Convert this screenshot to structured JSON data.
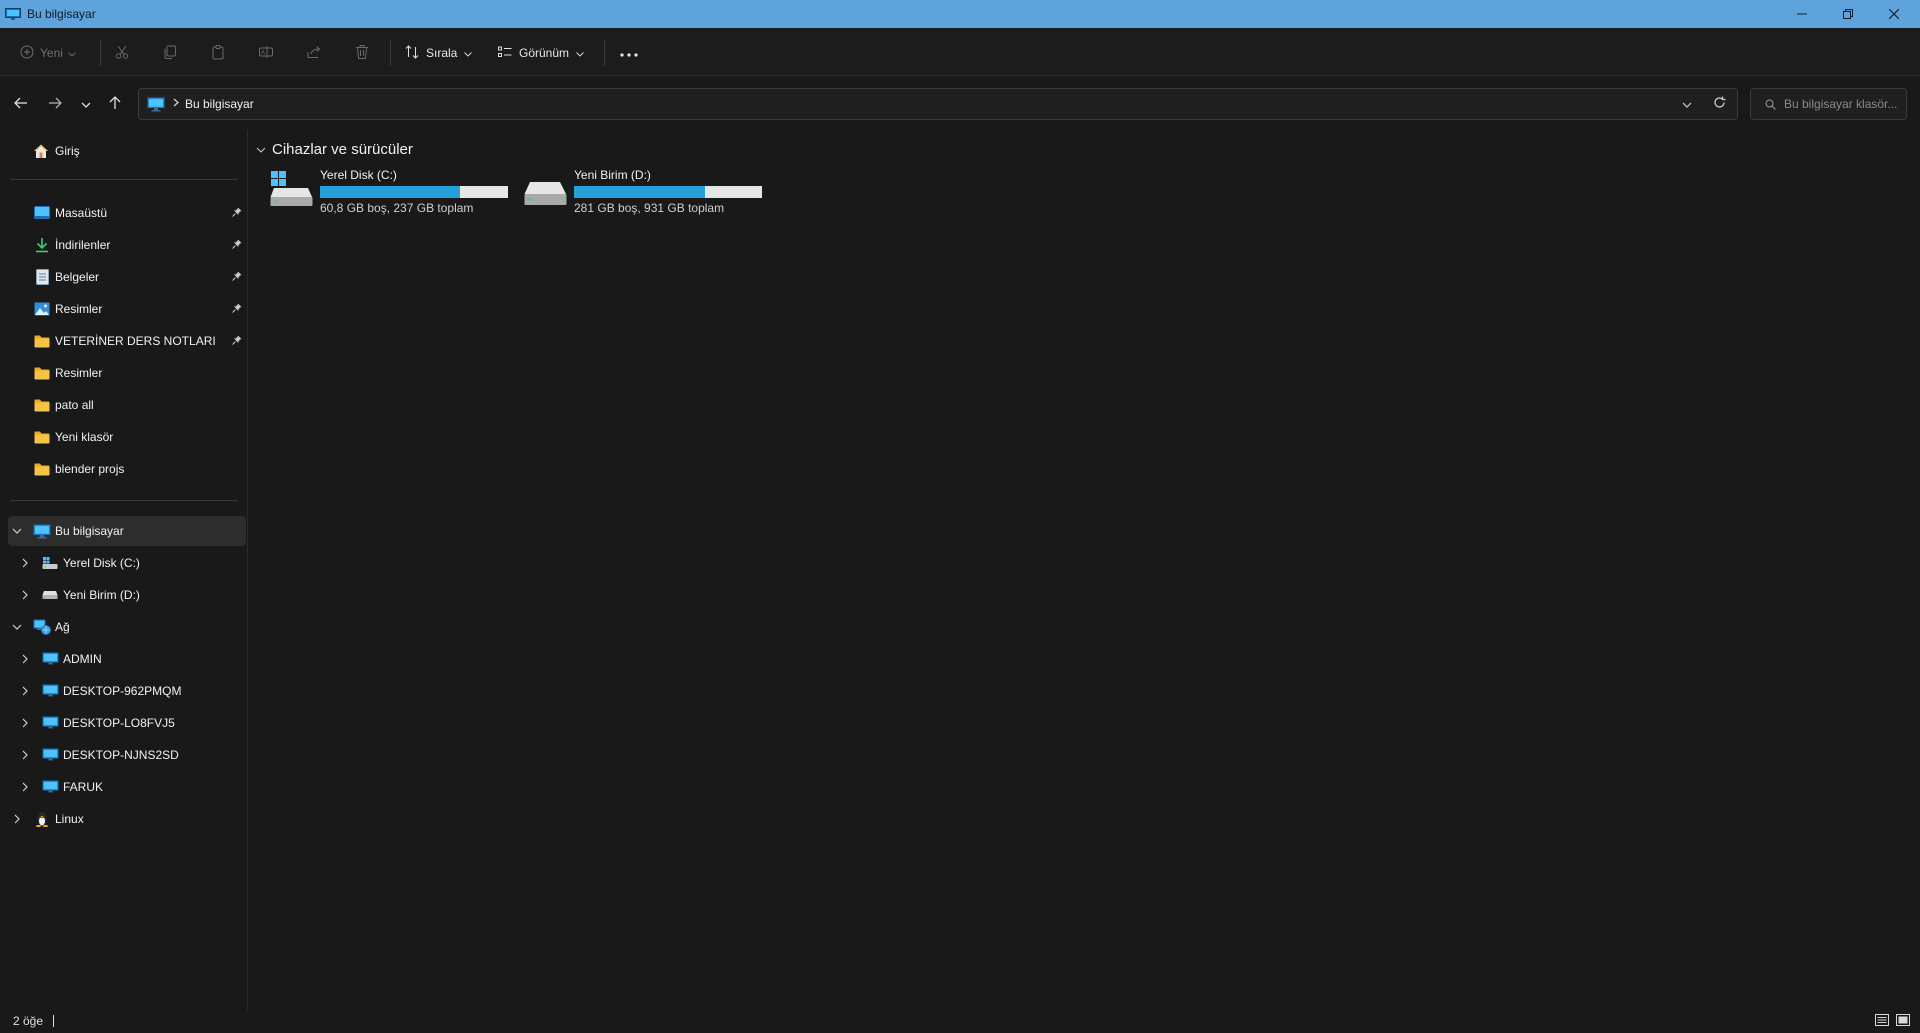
{
  "window": {
    "title": "Bu bilgisayar"
  },
  "toolbar": {
    "new_label": "Yeni",
    "sort_label": "Sırala",
    "view_label": "Görünüm",
    "more_label": "..."
  },
  "address": {
    "crumb": "Bu bilgisayar",
    "search_placeholder": "Bu bilgisayar klasör..."
  },
  "sidebar": {
    "home": "Giriş",
    "quick_access": [
      {
        "label": "Masaüstü",
        "icon": "desktop-icon",
        "pinned": true
      },
      {
        "label": "İndirilenler",
        "icon": "download-icon",
        "pinned": true
      },
      {
        "label": "Belgeler",
        "icon": "documents-icon",
        "pinned": true
      },
      {
        "label": "Resimler",
        "icon": "pictures-icon",
        "pinned": true
      },
      {
        "label": "VETERİNER DERS NOTLARI",
        "icon": "folder-icon",
        "pinned": true
      },
      {
        "label": "Resimler",
        "icon": "folder-icon",
        "pinned": false
      },
      {
        "label": "pato all",
        "icon": "folder-icon",
        "pinned": false
      },
      {
        "label": "Yeni klasör",
        "icon": "folder-icon",
        "pinned": false
      },
      {
        "label": "blender projs",
        "icon": "folder-icon",
        "pinned": false
      }
    ],
    "this_pc": "Bu bilgisayar",
    "drives": [
      "Yerel Disk (C:)",
      "Yeni Birim (D:)"
    ],
    "network": "Ağ",
    "network_hosts": [
      "ADMIN",
      "DESKTOP-962PMQM",
      "DESKTOP-LO8FVJ5",
      "DESKTOP-NJNS2SD",
      "FARUK"
    ],
    "linux": "Linux"
  },
  "content": {
    "section_title": "Cihazlar ve sürücüler",
    "drives": [
      {
        "name": "Yerel Disk (C:)",
        "info": "60,8 GB boş, 237 GB toplam",
        "used_fraction": 0.744,
        "icon": "windows-drive-icon"
      },
      {
        "name": "Yeni Birim (D:)",
        "info": "281 GB boş, 931 GB toplam",
        "used_fraction": 0.698,
        "icon": "drive-icon"
      }
    ]
  },
  "status": {
    "item_count": "2 öğe"
  },
  "colors": {
    "titlebar": "#5fa3dc",
    "accent": "#26a0da",
    "folder": "#f6c343",
    "background": "#191919"
  }
}
